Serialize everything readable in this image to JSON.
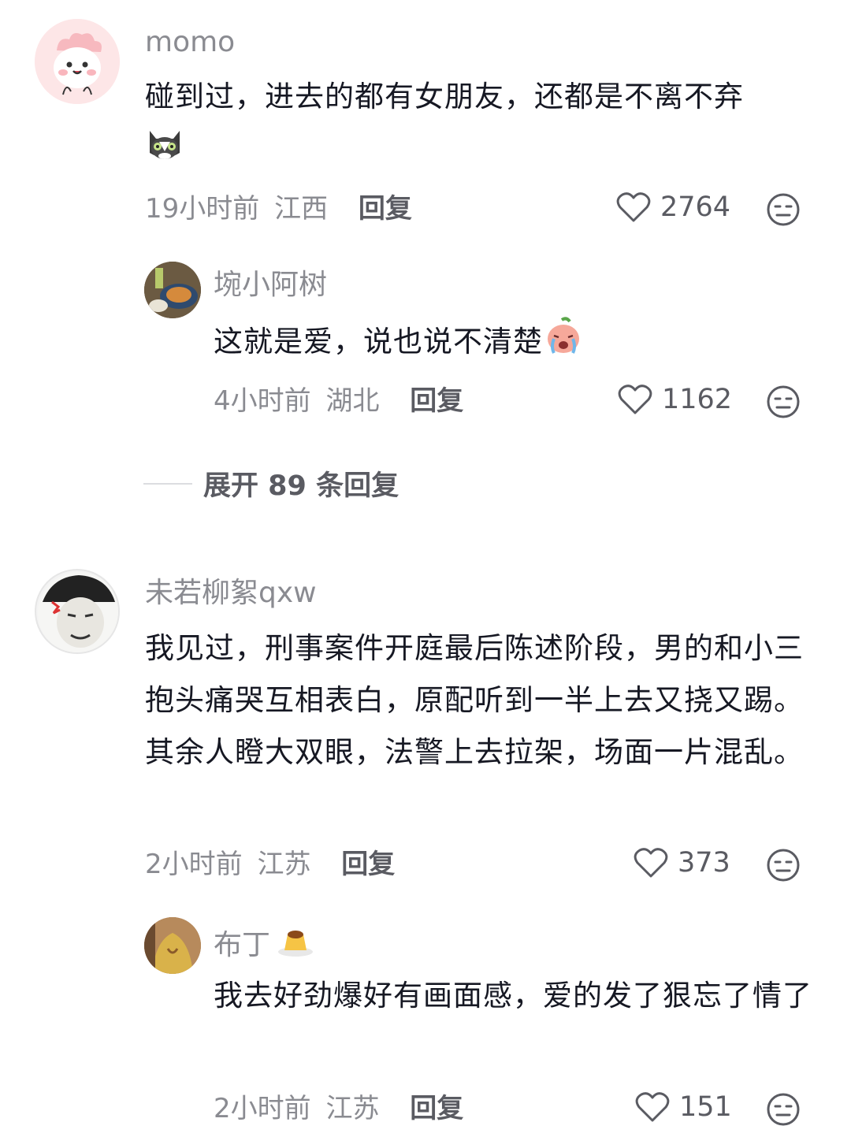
{
  "comments": [
    {
      "avatar_icon": "pink-dino-avatar",
      "name": "momo",
      "text": "碰到过，进去的都有女朋友，还都是不离不弃",
      "emoji_icon": "cat-emoji",
      "time": "19小时前",
      "location": "江西",
      "reply_label": "回复",
      "likes": "2764",
      "replies": [
        {
          "avatar_icon": "food-photo-avatar",
          "name": "埦小阿树",
          "text": "这就是爱，说也说不清楚",
          "emoji_icon": "crying-peach-emoji",
          "time": "4小时前",
          "location": "湖北",
          "reply_label": "回复",
          "likes": "1162"
        }
      ],
      "expand_label": "展开 89 条回复"
    },
    {
      "avatar_icon": "meme-face-avatar",
      "name": "未若柳絮qxw",
      "text": "我见过，刑事案件开庭最后陈述阶段，男的和小三抱头痛哭互相表白，原配听到一半上去又挠又踢。其余人瞪大双眼，法警上去拉架，场面一片混乱。",
      "time": "2小时前",
      "location": "江苏",
      "reply_label": "回复",
      "likes": "373",
      "replies": [
        {
          "avatar_icon": "photo-avatar",
          "name": "布丁",
          "name_emoji_icon": "pudding-emoji",
          "text": "我去好劲爆好有画面感，爱的发了狠忘了情了",
          "time": "2小时前",
          "location": "江苏",
          "reply_label": "回复",
          "likes": "151"
        }
      ]
    }
  ]
}
